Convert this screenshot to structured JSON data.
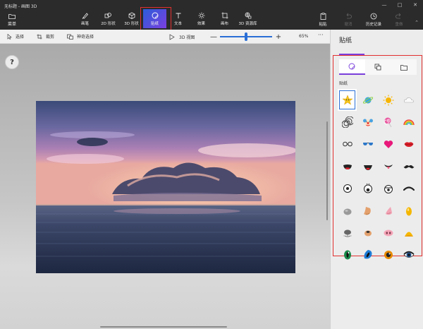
{
  "window": {
    "title": "无标题 - 画图 3D",
    "controls": [
      "—",
      "□",
      "✕"
    ]
  },
  "ribbon": {
    "menu_label": "菜单",
    "tools": [
      {
        "label": "画笔",
        "icon": "brush-icon",
        "active": false
      },
      {
        "label": "2D 形状",
        "icon": "2d-shapes-icon",
        "active": false
      },
      {
        "label": "3D 形状",
        "icon": "3d-shapes-icon",
        "active": false
      },
      {
        "label": "贴纸",
        "icon": "sticker-icon",
        "active": true
      },
      {
        "label": "文本",
        "icon": "text-icon",
        "active": false
      },
      {
        "label": "效果",
        "icon": "effects-icon",
        "active": false
      },
      {
        "label": "画布",
        "icon": "canvas-icon",
        "active": false
      },
      {
        "label": "3D 资源库",
        "icon": "3d-library-icon",
        "active": false
      }
    ],
    "right_tools": [
      {
        "label": "粘贴",
        "icon": "paste-icon",
        "enabled": true
      },
      {
        "label": "撤消",
        "icon": "undo-icon",
        "enabled": false
      },
      {
        "label": "历史记录",
        "icon": "history-icon",
        "enabled": true
      },
      {
        "label": "重做",
        "icon": "redo-icon",
        "enabled": false
      }
    ]
  },
  "toolbar": {
    "select_label": "选择",
    "crop_label": "裁剪",
    "magic_select_label": "神奇选择",
    "view3d_label": "3D 视图",
    "zoom_minus": "—",
    "zoom_plus": "+",
    "zoom_fraction": 0.5,
    "zoom_value": "65%",
    "more_label": "···"
  },
  "canvas": {
    "help_label": "?",
    "image": "sunset-over-ocean-photo"
  },
  "panel": {
    "title": "贴纸",
    "tabs": [
      {
        "icon": "sticker-smiley-icon",
        "active": true
      },
      {
        "icon": "shapes-icon",
        "active": false
      },
      {
        "icon": "folder-icon",
        "active": false
      }
    ],
    "section_label": "贴纸",
    "stickers": [
      "star-face",
      "planet",
      "sun",
      "cloud",
      "spiral",
      "clown-face",
      "lollipop",
      "rainbow",
      "glasses",
      "sunglasses",
      "heart",
      "lips",
      "open-mouth",
      "smiling-mouth",
      "tongue-mouth",
      "mustache",
      "cartoon-eye",
      "round-eye",
      "half-eye",
      "eyebrow",
      "gray-nose",
      "tan-nose",
      "pink-nose",
      "yellow-nose",
      "gray-animal-nose",
      "tan-animal-nose",
      "pig-nose",
      "yellow-beak",
      "green-eye",
      "blue-eye",
      "orange-eye",
      "dark-eye"
    ],
    "selected_sticker": 0
  },
  "colors": {
    "accent": "#7a3fdb",
    "highlight": "#e23030",
    "ribbon_bg": "#2b2b2b"
  }
}
